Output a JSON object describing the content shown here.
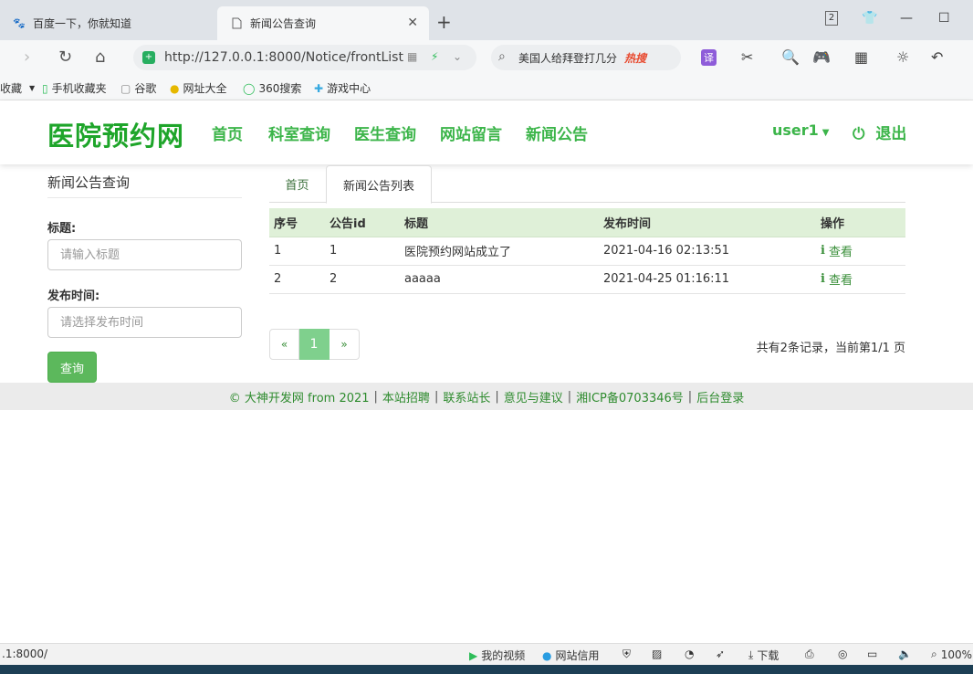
{
  "browser": {
    "tabs": [
      {
        "title": "百度一下，你就知道",
        "icon": "baidu-icon"
      },
      {
        "title": "新闻公告查询",
        "icon": "page-icon",
        "active": true
      }
    ],
    "tab_count_badge": "2",
    "url": "http://127.0.0.1:8000/Notice/frontList",
    "search_text": "美国人给拜登打几分",
    "search_badge": "热搜",
    "translate_label": "译",
    "bookmarks": [
      {
        "label": "收藏",
        "icon": "bookmark-star-icon"
      },
      {
        "label": "手机收藏夹",
        "icon": "phone-icon"
      },
      {
        "label": "谷歌",
        "icon": "page-icon"
      },
      {
        "label": "网址大全",
        "icon": "globe-icon"
      },
      {
        "label": "360搜索",
        "icon": "search-360-icon"
      },
      {
        "label": "游戏中心",
        "icon": "game-icon"
      }
    ]
  },
  "site": {
    "logo": "医院预约网",
    "nav": [
      "首页",
      "科室查询",
      "医生查询",
      "网站留言",
      "新闻公告"
    ],
    "user": "user1",
    "logout": "退出"
  },
  "sidebar": {
    "title": "新闻公告查询",
    "title_label": "标题:",
    "title_placeholder": "请输入标题",
    "date_label": "发布时间:",
    "date_placeholder": "请选择发布时间",
    "query_button": "查询"
  },
  "main": {
    "tabs": [
      "首页",
      "新闻公告列表"
    ],
    "columns": [
      "序号",
      "公告id",
      "标题",
      "发布时间",
      "操作"
    ],
    "rows": [
      {
        "no": "1",
        "id": "1",
        "title": "医院预约网站成立了",
        "time": "2021-04-16 02:13:51",
        "action": "查看"
      },
      {
        "no": "2",
        "id": "2",
        "title": "aaaaa",
        "time": "2021-04-25 01:16:11",
        "action": "查看"
      }
    ],
    "pager": {
      "prev": "«",
      "current": "1",
      "next": "»"
    },
    "page_info": "共有2条记录，当前第1/1 页"
  },
  "footer": {
    "copyright": "© 大神开发网 from 2021",
    "links": [
      "本站招聘",
      "联系站长",
      "意见与建议",
      "湘ICP备0703346号",
      "后台登录"
    ]
  },
  "statusbar": {
    "url": ".1:8000/",
    "items": [
      "我的视频",
      "网站信用",
      "下载"
    ],
    "zoom": "100%"
  }
}
